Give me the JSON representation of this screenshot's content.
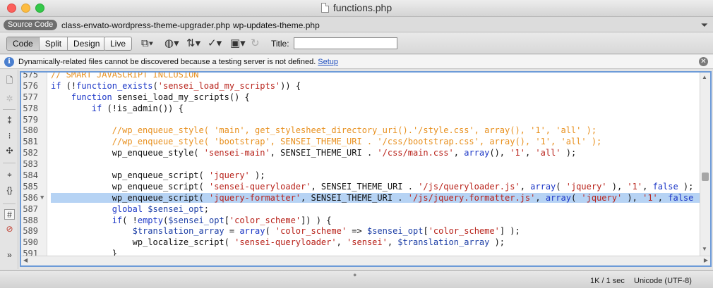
{
  "window": {
    "title": "functions.php"
  },
  "related_files": {
    "source_code": "Source Code",
    "files": [
      "class-envato-wordpress-theme-upgrader.php",
      "wp-updates-theme.php"
    ]
  },
  "toolbar": {
    "views": [
      "Code",
      "Split",
      "Design"
    ],
    "active_view": "Code",
    "live": "Live",
    "title_label": "Title:",
    "title_value": ""
  },
  "infobar": {
    "message": "Dynamically-related files cannot be discovered because a testing server is not defined.",
    "link": "Setup"
  },
  "code_lines": [
    {
      "num": "575",
      "tokens": [
        [
          "cmt",
          "// SMART JAVASCRIPT INCLUSION"
        ]
      ]
    },
    {
      "num": "576",
      "tokens": [
        [
          "kw",
          "if"
        ],
        [
          "txt",
          " (!"
        ],
        [
          "kw",
          "function_exists"
        ],
        [
          "txt",
          "("
        ],
        [
          "str",
          "'sensei_load_my_scripts'"
        ],
        [
          "txt",
          ")) {"
        ]
      ]
    },
    {
      "num": "577",
      "tokens": [
        [
          "txt",
          "    "
        ],
        [
          "kw",
          "function"
        ],
        [
          "txt",
          " sensei_load_my_scripts() {"
        ]
      ]
    },
    {
      "num": "578",
      "tokens": [
        [
          "txt",
          "        "
        ],
        [
          "kw",
          "if"
        ],
        [
          "txt",
          " (!is_admin()) {"
        ]
      ]
    },
    {
      "num": "579",
      "tokens": []
    },
    {
      "num": "580",
      "tokens": [
        [
          "txt",
          "            "
        ],
        [
          "cmt",
          "//wp_enqueue_style( 'main', get_stylesheet_directory_uri().'/style.css', array(), '1', 'all' );"
        ]
      ]
    },
    {
      "num": "581",
      "tokens": [
        [
          "txt",
          "            "
        ],
        [
          "cmt",
          "//wp_enqueue_style( 'bootstrap', SENSEI_THEME_URI . '/css/bootstrap.css', array(), '1', 'all' );"
        ]
      ]
    },
    {
      "num": "582",
      "tokens": [
        [
          "txt",
          "            wp_enqueue_style( "
        ],
        [
          "str",
          "'sensei-main'"
        ],
        [
          "txt",
          ", SENSEI_THEME_URI . "
        ],
        [
          "str",
          "'/css/main.css'"
        ],
        [
          "txt",
          ", "
        ],
        [
          "kw",
          "array"
        ],
        [
          "txt",
          "(), "
        ],
        [
          "str",
          "'1'"
        ],
        [
          "txt",
          ", "
        ],
        [
          "str",
          "'all'"
        ],
        [
          "txt",
          " );"
        ]
      ]
    },
    {
      "num": "583",
      "tokens": []
    },
    {
      "num": "584",
      "tokens": [
        [
          "txt",
          "            wp_enqueue_script( "
        ],
        [
          "str",
          "'jquery'"
        ],
        [
          "txt",
          " );"
        ]
      ]
    },
    {
      "num": "585",
      "tokens": [
        [
          "txt",
          "            wp_enqueue_script( "
        ],
        [
          "str",
          "'sensei-queryloader'"
        ],
        [
          "txt",
          ", SENSEI_THEME_URI . "
        ],
        [
          "str",
          "'/js/queryloader.js'"
        ],
        [
          "txt",
          ", "
        ],
        [
          "kw",
          "array"
        ],
        [
          "txt",
          "( "
        ],
        [
          "str",
          "'jquery'"
        ],
        [
          "txt",
          " ), "
        ],
        [
          "str",
          "'1'"
        ],
        [
          "txt",
          ", "
        ],
        [
          "kw",
          "false"
        ],
        [
          "txt",
          " );"
        ]
      ]
    },
    {
      "num": "586",
      "selected": true,
      "fold": "▼",
      "tokens": [
        [
          "txt",
          "            wp_enqueue_script( "
        ],
        [
          "str",
          "'jquery-formatter'"
        ],
        [
          "txt",
          ", SENSEI_THEME_URI . "
        ],
        [
          "str",
          "'/js/jquery.formatter.js'"
        ],
        [
          "txt",
          ", "
        ],
        [
          "kw",
          "array"
        ],
        [
          "txt",
          "( "
        ],
        [
          "str",
          "'jquery'"
        ],
        [
          "txt",
          " ), "
        ],
        [
          "str",
          "'1'"
        ],
        [
          "txt",
          ", "
        ],
        [
          "kw",
          "false"
        ],
        [
          "txt",
          " );"
        ]
      ]
    },
    {
      "num": "587",
      "tokens": [
        [
          "txt",
          "            "
        ],
        [
          "kw",
          "global"
        ],
        [
          "txt",
          " "
        ],
        [
          "var",
          "$sensei_opt"
        ],
        [
          "txt",
          ";"
        ]
      ]
    },
    {
      "num": "588",
      "tokens": [
        [
          "txt",
          "            "
        ],
        [
          "kw",
          "if"
        ],
        [
          "txt",
          "( !"
        ],
        [
          "kw",
          "empty"
        ],
        [
          "txt",
          "("
        ],
        [
          "var",
          "$sensei_opt"
        ],
        [
          "txt",
          "["
        ],
        [
          "str",
          "'color_scheme'"
        ],
        [
          "txt",
          "]) ) {"
        ]
      ]
    },
    {
      "num": "589",
      "tokens": [
        [
          "txt",
          "                "
        ],
        [
          "var",
          "$translation_array"
        ],
        [
          "txt",
          " = "
        ],
        [
          "kw",
          "array"
        ],
        [
          "txt",
          "( "
        ],
        [
          "str",
          "'color_scheme'"
        ],
        [
          "txt",
          " => "
        ],
        [
          "var",
          "$sensei_opt"
        ],
        [
          "txt",
          "["
        ],
        [
          "str",
          "'color_scheme'"
        ],
        [
          "txt",
          "] );"
        ]
      ]
    },
    {
      "num": "590",
      "tokens": [
        [
          "txt",
          "                wp_localize_script( "
        ],
        [
          "str",
          "'sensei-queryloader'"
        ],
        [
          "txt",
          ", "
        ],
        [
          "str",
          "'sensei'"
        ],
        [
          "txt",
          ", "
        ],
        [
          "var",
          "$translation_array"
        ],
        [
          "txt",
          " );"
        ]
      ]
    },
    {
      "num": "591",
      "tokens": [
        [
          "txt",
          "            }"
        ]
      ]
    }
  ],
  "status": {
    "size": "1K / 1 sec",
    "encoding": "Unicode (UTF-8)"
  }
}
